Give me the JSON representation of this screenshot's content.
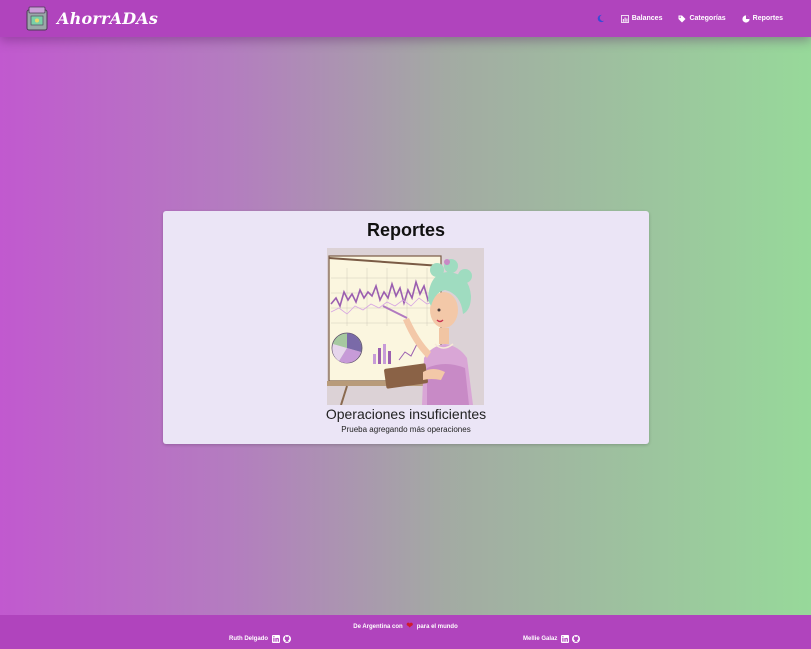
{
  "app": {
    "name": "AhorrADAs"
  },
  "nav": {
    "theme_toggle_icon": "moon-icon",
    "items": [
      {
        "label": "Balances",
        "icon": "chart-icon"
      },
      {
        "label": "Categorías",
        "icon": "tag-icon"
      },
      {
        "label": "Reportes",
        "icon": "pie-chart-icon"
      }
    ]
  },
  "report": {
    "title": "Reportes",
    "empty_title": "Operaciones insuficientes",
    "empty_subtitle": "Prueba agregando más operaciones"
  },
  "footer": {
    "prefix": "De Argentina con",
    "suffix": "para el mundo",
    "authors": [
      {
        "name": "Ruth Delgado"
      },
      {
        "name": "Mellie Galaz"
      }
    ]
  },
  "colors": {
    "navbar": "#b044bd",
    "card": "#ebe5f6",
    "accent_moon": "#3a4bd6",
    "heart": "#d01c2c"
  }
}
